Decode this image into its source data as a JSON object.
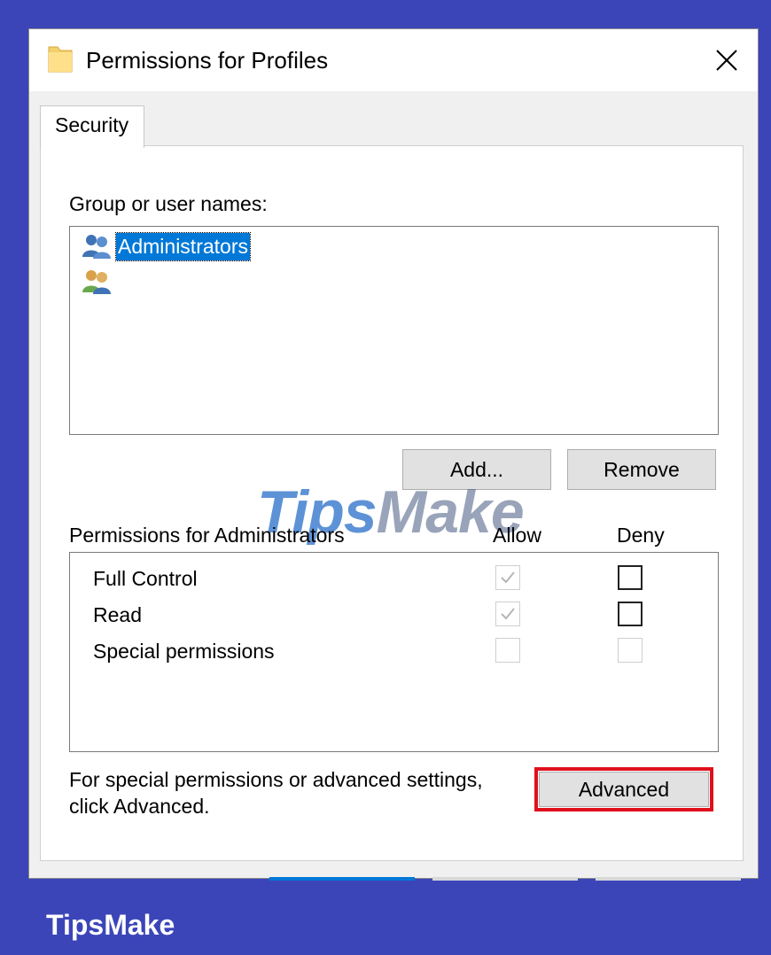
{
  "window": {
    "title": "Permissions for Profiles",
    "icon": "folder-icon",
    "close": "close-icon"
  },
  "tabs": [
    {
      "label": "Security",
      "active": true
    }
  ],
  "groups": {
    "label": "Group or user names:",
    "items": [
      {
        "name": "Administrators",
        "icon": "user-group-icon",
        "selected": true
      },
      {
        "name": "",
        "icon": "user-group-icon",
        "selected": false
      }
    ]
  },
  "buttons": {
    "add": "Add...",
    "remove": "Remove",
    "advanced": "Advanced"
  },
  "permissions": {
    "label": "Permissions for Administrators",
    "allow_header": "Allow",
    "deny_header": "Deny",
    "rows": [
      {
        "name": "Full Control",
        "allow": true,
        "allow_enabled": false,
        "deny": false,
        "deny_enabled": true
      },
      {
        "name": "Read",
        "allow": true,
        "allow_enabled": false,
        "deny": false,
        "deny_enabled": true
      },
      {
        "name": "Special permissions",
        "allow": false,
        "allow_enabled": false,
        "deny": false,
        "deny_enabled": false
      }
    ]
  },
  "advanced_note": {
    "line1": "For special permissions or advanced settings,",
    "line2": "click Advanced."
  },
  "watermark": {
    "part1": "Tips",
    "part2": "Make"
  },
  "brand": "TipsMake",
  "colors": {
    "frame": "#3b45b8",
    "selection": "#0078d7",
    "highlight": "#e0101c"
  }
}
